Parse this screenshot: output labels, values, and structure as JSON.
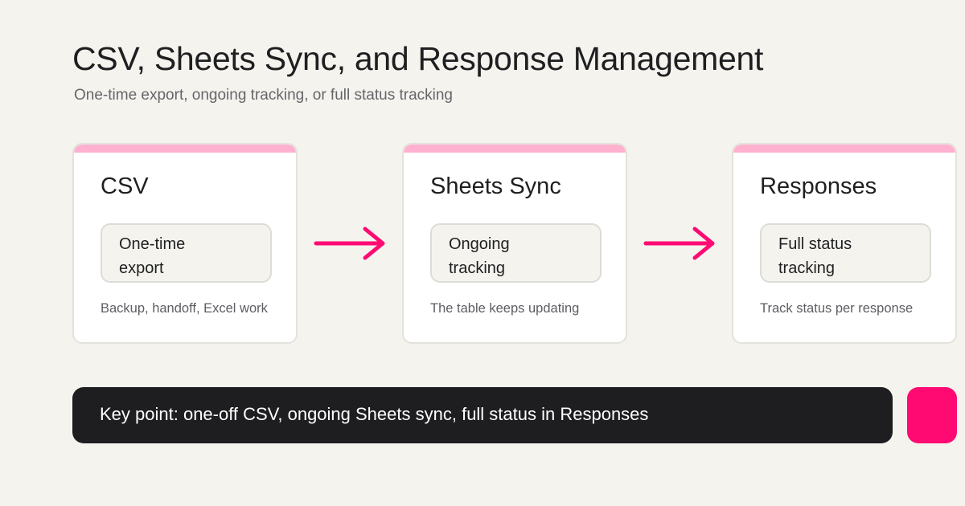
{
  "header": {
    "title": "CSV, Sheets Sync, and Response Management",
    "subtitle": "One-time export, ongoing tracking, or full status tracking"
  },
  "cards": [
    {
      "title": "CSV",
      "pill_lines": [
        "One-time",
        "export"
      ],
      "description": "Backup, handoff, Excel work"
    },
    {
      "title": "Sheets Sync",
      "pill_lines": [
        "Ongoing",
        "tracking"
      ],
      "description": "The table keeps updating"
    },
    {
      "title": "Responses",
      "pill_lines": [
        "Full status",
        "tracking"
      ],
      "description": "Track status per response"
    }
  ],
  "connectors": [
    {
      "from": "CSV",
      "to": "Sheets Sync",
      "icon": "arrow-right-icon"
    },
    {
      "from": "Sheets Sync",
      "to": "Responses",
      "icon": "arrow-right-icon"
    }
  ],
  "keypoint": {
    "text": "Key point: one-off CSV, ongoing Sheets sync, full status in Responses"
  },
  "colors": {
    "background": "#f4f3ee",
    "card_bar": "#ffb1cf",
    "arrow": "#ff0a72",
    "accent": "#ff0a72",
    "keypoint_bg": "#1e1e20"
  }
}
